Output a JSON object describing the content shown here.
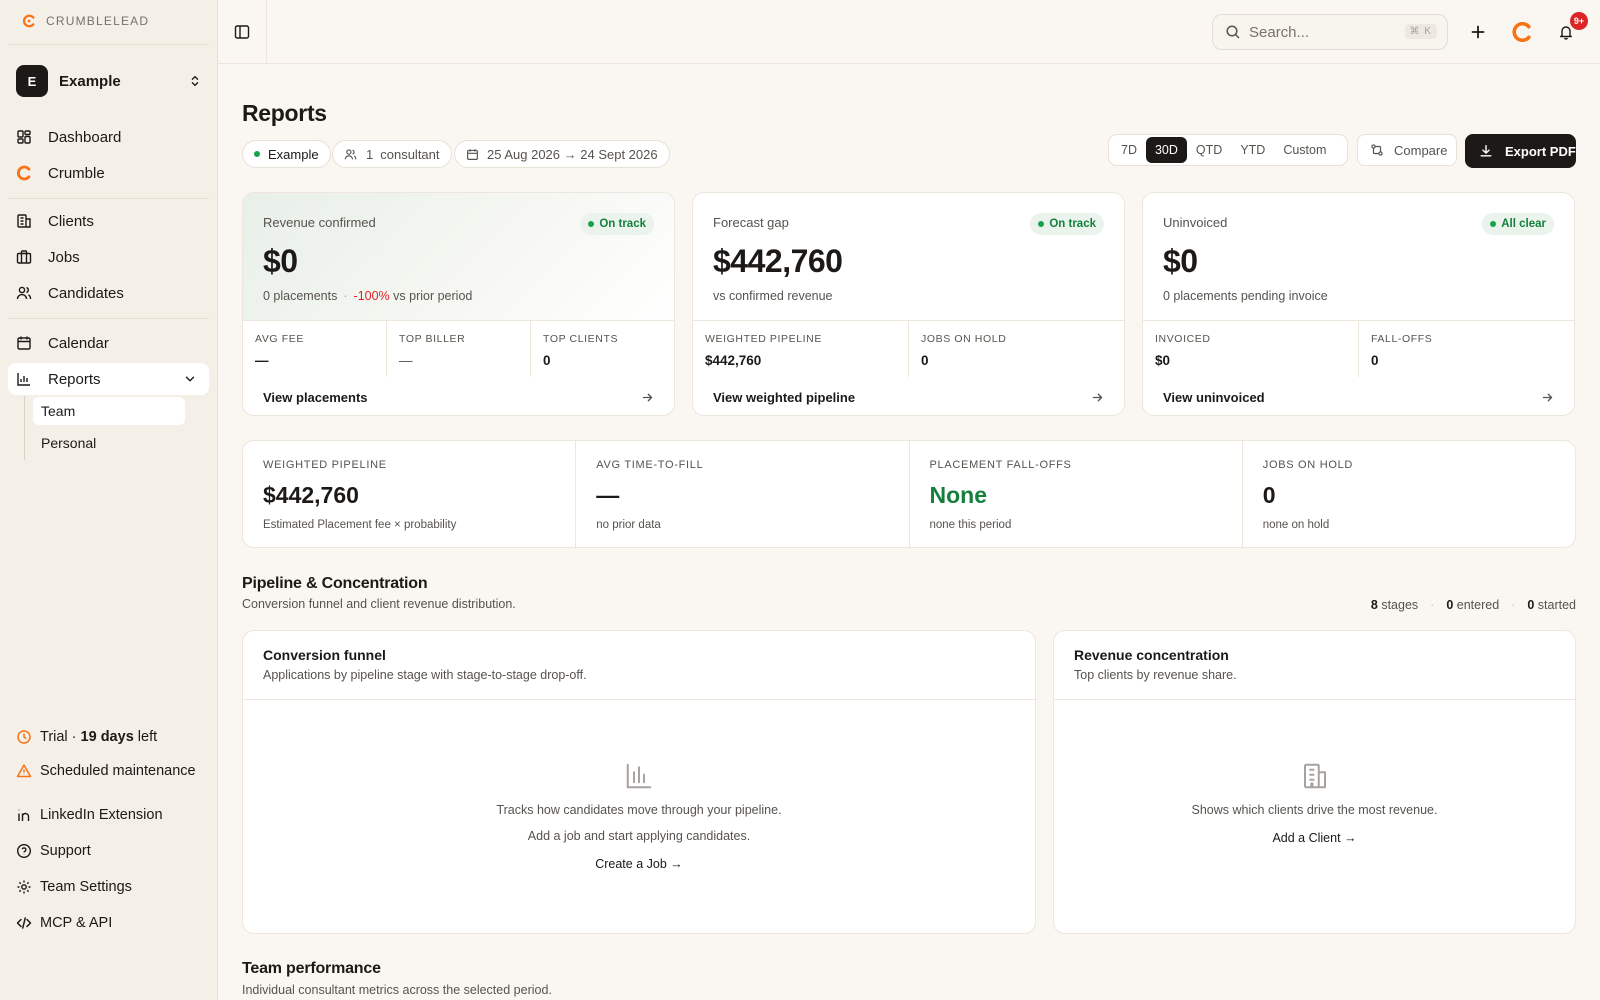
{
  "brand": {
    "name": "CRUMBLELEAD",
    "accent": "#f97316"
  },
  "workspace": {
    "initial": "E",
    "name": "Example"
  },
  "nav": {
    "dashboard": "Dashboard",
    "crumble": "Crumble",
    "clients": "Clients",
    "jobs": "Jobs",
    "candidates": "Candidates",
    "calendar": "Calendar",
    "reports": "Reports",
    "reports_sub": [
      "Team",
      "Personal"
    ]
  },
  "footer": {
    "trial_prefix": "Trial · ",
    "trial_days": "19 days",
    "trial_suffix": " left",
    "maintenance": "Scheduled maintenance",
    "linkedin": "LinkedIn Extension",
    "support": "Support",
    "team_settings": "Team Settings",
    "mcp": "MCP & API"
  },
  "topbar": {
    "search_placeholder": "Search...",
    "search_kbd": "⌘ K",
    "notifications_badge": "9+"
  },
  "page": {
    "title": "Reports",
    "chips": {
      "workspace": "Example",
      "consultant_count": "1",
      "consultant_label": "consultant",
      "date_range": "25 Aug 2026 → 24 Sept 2026"
    },
    "periods": [
      "7D",
      "30D",
      "QTD",
      "YTD",
      "Custom"
    ],
    "active_period": "30D",
    "compare": "Compare",
    "export": "Export PDF"
  },
  "cards": [
    {
      "label": "Revenue confirmed",
      "status": "On track",
      "value": "$0",
      "sub_a": "0 placements",
      "sub_sep": "·",
      "sub_neg": "-100%",
      "sub_b": " vs prior period",
      "metrics": [
        {
          "label": "AVG FEE",
          "value": "—"
        },
        {
          "label": "TOP BILLER",
          "value": "—"
        },
        {
          "label": "TOP CLIENTS",
          "value": "0"
        }
      ],
      "link": "View placements"
    },
    {
      "label": "Forecast gap",
      "status": "On track",
      "value": "$442,760",
      "sub": "vs confirmed revenue",
      "metrics": [
        {
          "label": "WEIGHTED PIPELINE",
          "value": "$442,760"
        },
        {
          "label": "JOBS ON HOLD",
          "value": "0"
        }
      ],
      "link": "View weighted pipeline"
    },
    {
      "label": "Uninvoiced",
      "status": "All clear",
      "value": "$0",
      "sub": "0 placements pending invoice",
      "metrics": [
        {
          "label": "INVOICED",
          "value": "$0"
        },
        {
          "label": "FALL-OFFS",
          "value": "0"
        }
      ],
      "link": "View uninvoiced"
    }
  ],
  "stats": [
    {
      "label": "WEIGHTED PIPELINE",
      "value": "$442,760",
      "sub": "Estimated Placement fee × probability"
    },
    {
      "label": "AVG TIME-TO-FILL",
      "value": "—",
      "sub": "no prior data"
    },
    {
      "label": "PLACEMENT FALL-OFFS",
      "value": "None",
      "sub": "none this period"
    },
    {
      "label": "JOBS ON HOLD",
      "value": "0",
      "sub": "none on hold"
    }
  ],
  "pipeline_section": {
    "title": "Pipeline & Concentration",
    "subtitle": "Conversion funnel and client revenue distribution.",
    "stages": "8",
    "stages_label": "stages",
    "entered": "0",
    "entered_label": "entered",
    "started": "0",
    "started_label": "started"
  },
  "funnel_panel": {
    "title": "Conversion funnel",
    "subtitle": "Applications by pipeline stage with stage-to-stage drop-off.",
    "empty_line1": "Tracks how candidates move through your pipeline.",
    "empty_line2": "Add a job and start applying candidates.",
    "cta": "Create a Job →"
  },
  "concentration_panel": {
    "title": "Revenue concentration",
    "subtitle": "Top clients by revenue share.",
    "empty_line1": "Shows which clients drive the most revenue.",
    "cta": "Add a Client →"
  },
  "team_section": {
    "title": "Team performance",
    "subtitle": "Individual consultant metrics across the selected period."
  }
}
